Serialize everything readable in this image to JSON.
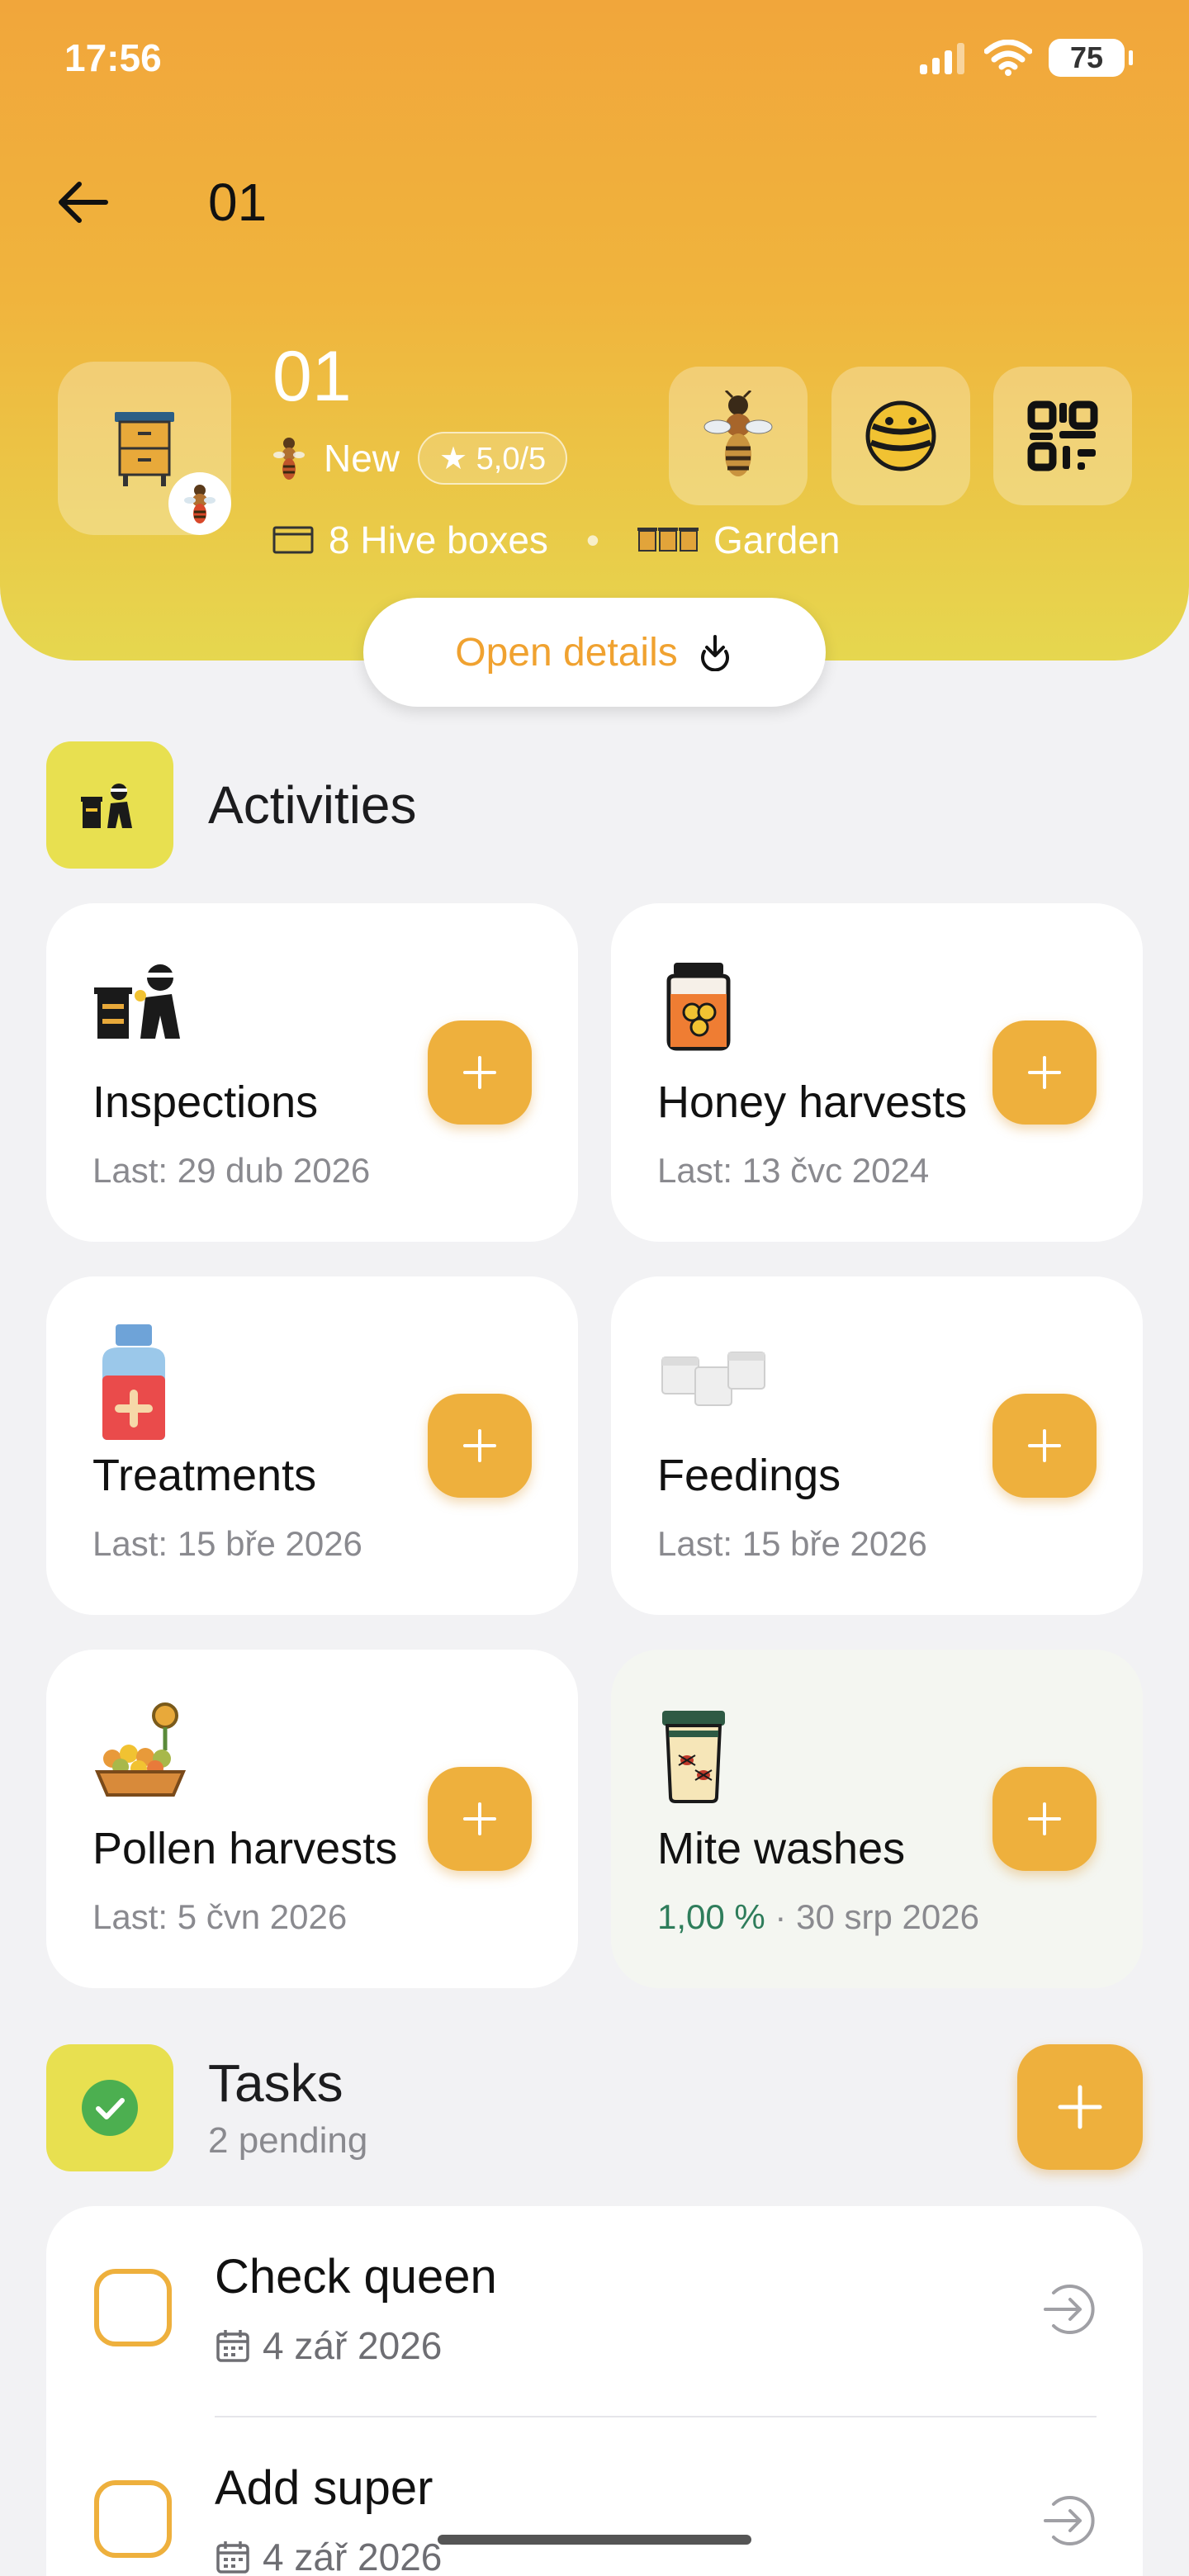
{
  "status_bar": {
    "time": "17:56",
    "battery": "75"
  },
  "nav": {
    "title": "01"
  },
  "hive": {
    "name": "01",
    "status": "New",
    "rating": "★ 5,0/5",
    "boxes": "8 Hive boxes",
    "location": "Garden"
  },
  "open_details": {
    "label": "Open details"
  },
  "activities": {
    "title": "Activities",
    "items": [
      {
        "name": "Inspections",
        "last": "Last: 29 dub 2026"
      },
      {
        "name": "Honey harvests",
        "last": "Last: 13 čvc 2024"
      },
      {
        "name": "Treatments",
        "last": "Last: 15 bře 2026"
      },
      {
        "name": "Feedings",
        "last": "Last: 15 bře 2026"
      },
      {
        "name": "Pollen harvests",
        "last": "Last: 5 čvn 2026"
      },
      {
        "name": "Mite washes",
        "value": "1,00 %",
        "date": " · 30 srp 2026"
      }
    ]
  },
  "tasks": {
    "title": "Tasks",
    "subtitle": "2 pending",
    "items": [
      {
        "title": "Check queen",
        "date": "4 zář 2026"
      },
      {
        "title": "Add super",
        "date": "4 zář 2026"
      }
    ]
  },
  "colors": {
    "accent": "#eeb03d",
    "header_top": "#f1a63b",
    "header_bottom": "#e6d74f",
    "section_icon_bg": "#e8e050",
    "positive": "#2e7d5b"
  }
}
